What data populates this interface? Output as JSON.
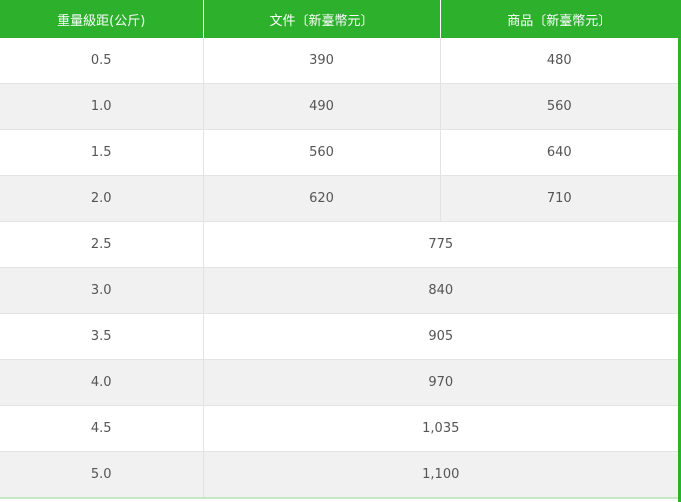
{
  "table": {
    "headers": [
      "重量級距(公斤)",
      "文件〔新臺幣元〕",
      "商品〔新臺幣元〕"
    ],
    "rows_split": [
      {
        "weight": "0.5",
        "document": "390",
        "goods": "480"
      },
      {
        "weight": "1.0",
        "document": "490",
        "goods": "560"
      },
      {
        "weight": "1.5",
        "document": "560",
        "goods": "640"
      },
      {
        "weight": "2.0",
        "document": "620",
        "goods": "710"
      }
    ],
    "rows_merged": [
      {
        "weight": "2.5",
        "price": "775"
      },
      {
        "weight": "3.0",
        "price": "840"
      },
      {
        "weight": "3.5",
        "price": "905"
      },
      {
        "weight": "4.0",
        "price": "970"
      },
      {
        "weight": "4.5",
        "price": "1,035"
      },
      {
        "weight": "5.0",
        "price": "1,100"
      }
    ]
  },
  "colors": {
    "header_bg": "#2db12d",
    "header_text": "#ffffff",
    "row_alt_bg": "#f1f1f1",
    "cell_text": "#555555",
    "border": "#e3e3e3"
  }
}
